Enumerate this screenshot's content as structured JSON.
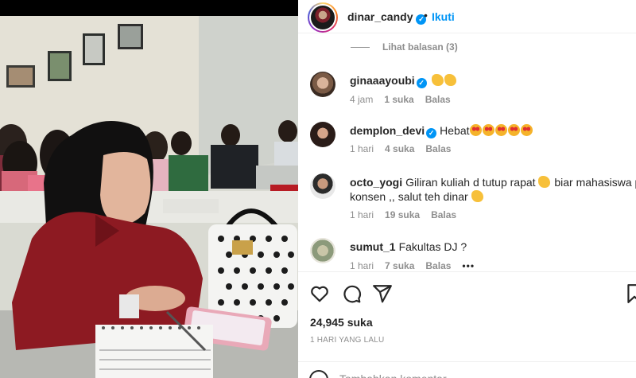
{
  "post": {
    "username": "dinar_candy",
    "verified_mark": "✓",
    "separator": "•",
    "follow_label": "Ikuti"
  },
  "comments": {
    "view_replies": "Lihat balasan (3)",
    "items": [
      {
        "user": "ginaaayoubi",
        "verified": "✓",
        "text": "",
        "emojis": [
          "clap",
          "clap"
        ],
        "time": "4 jam",
        "likes": "1 suka",
        "reply": "Balas"
      },
      {
        "user": "demplon_devi",
        "verified": "✓",
        "text": "Hebat",
        "emojis": [
          "star-struck",
          "star-struck",
          "star-struck",
          "star-struck",
          "star-struck"
        ],
        "time": "1 hari",
        "likes": "4 suka",
        "reply": "Balas"
      },
      {
        "user": "octo_yogi",
        "text_line1": "Giliran kuliah d tutup rapat",
        "text_line1b": "biar mahasiswa pada",
        "text_line2": "konsen ,, salut teh dinar",
        "emojis": [
          "clap",
          "clap"
        ],
        "time": "1 hari",
        "likes": "19 suka",
        "reply": "Balas"
      },
      {
        "user": "sumut_1",
        "text": "Fakultas DJ ?",
        "time": "1 hari",
        "likes": "7 suka",
        "reply": "Balas",
        "more": "•••"
      }
    ]
  },
  "actions": {
    "icons": [
      "heart-icon",
      "comment-icon",
      "share-icon",
      "save-icon"
    ],
    "likes_count": "24,945 suka",
    "posted_time": "1 HARI YANG LALU",
    "add_comment_placeholder": "Tambahkan komentar..."
  },
  "colors": {
    "accent": "#0095f6",
    "text": "#262626",
    "muted": "#8e8e8e"
  }
}
